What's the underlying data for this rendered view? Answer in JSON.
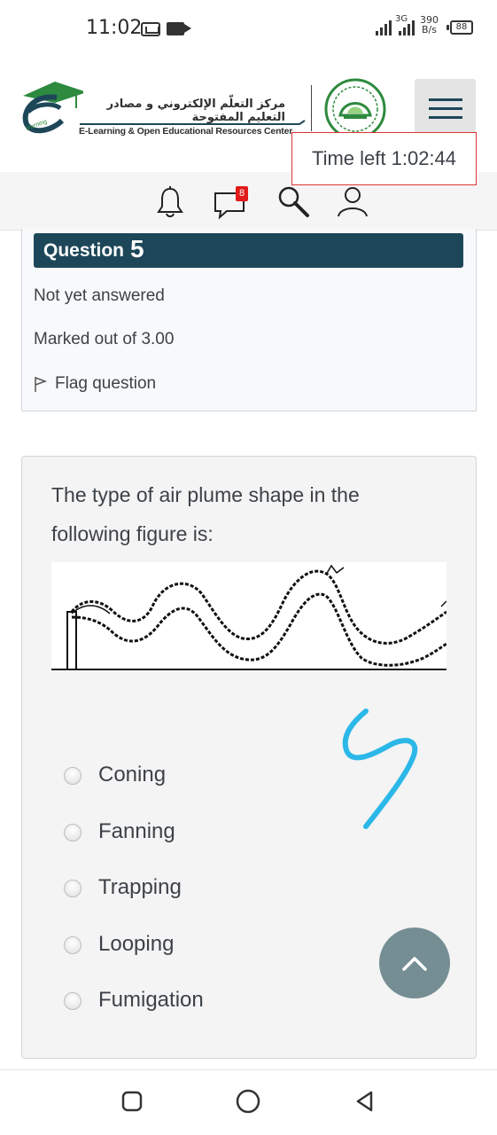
{
  "status_bar": {
    "time": "11:02",
    "network_type": "3G",
    "net_speed_value": "390",
    "net_speed_unit": "B/s",
    "battery": "88"
  },
  "header": {
    "logo_arabic": "مركز التعلّم الإلكتروني و مصادر التعليم المفتوحة",
    "logo_english": "E-Learning & Open Educational Resources Center",
    "timer": "Time left 1:02:44"
  },
  "icons_bar": {
    "messages_badge": "8"
  },
  "question": {
    "label": "Question",
    "number": "5",
    "status": "Not yet answered",
    "marks": "Marked out of 3.00",
    "flag": "Flag question",
    "text": "The type of air plume shape in the following figure is:",
    "options": [
      "Coning",
      "Fanning",
      "Trapping",
      "Looping",
      "Fumigation"
    ]
  },
  "colors": {
    "header_bar": "#1d4759",
    "timer_border": "#dd3333",
    "badge": "#e21a1a",
    "annotation": "#2bb8e8",
    "scroll_top": "#758e94"
  }
}
